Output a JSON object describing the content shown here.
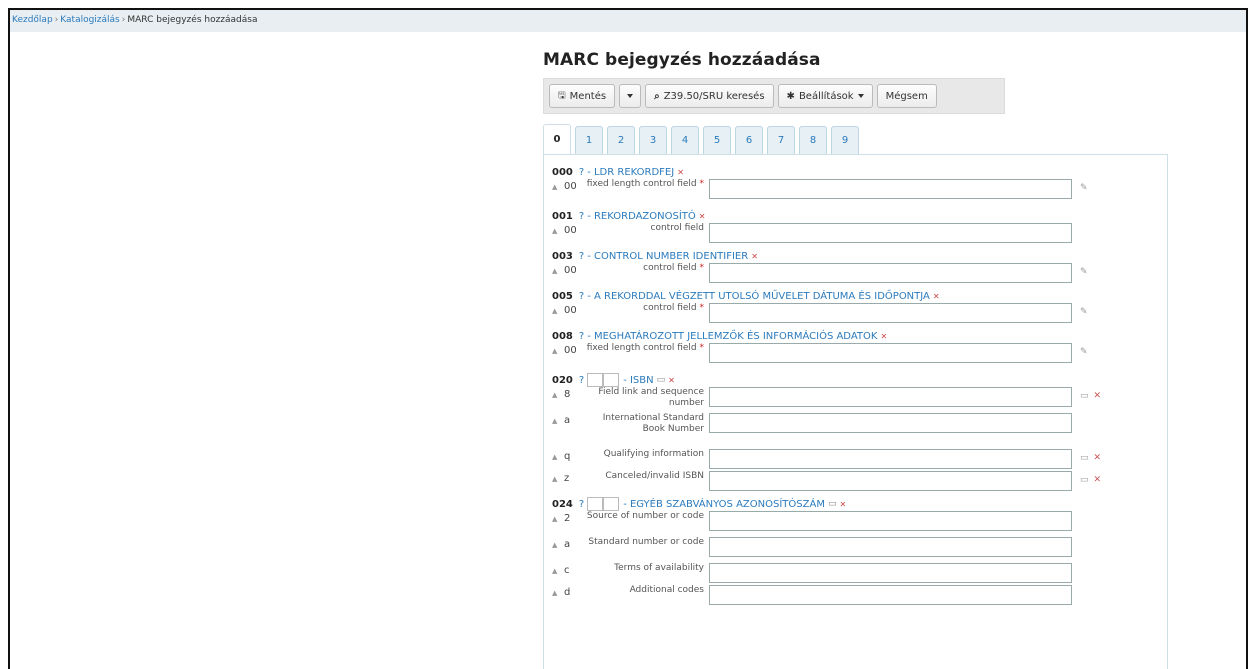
{
  "breadcrumbs": {
    "home": "Kezdőlap",
    "catalog": "Katalogizálás",
    "current": "MARC bejegyzés hozzáadása",
    "sep": "›"
  },
  "page_title": "MARC bejegyzés hozzáadása",
  "toolbar": {
    "save_label": "Mentés",
    "search_label": "Z39.50/SRU keresés",
    "settings_label": "Beállítások",
    "cancel_label": "Mégsem"
  },
  "tabs": [
    "0",
    "1",
    "2",
    "3",
    "4",
    "5",
    "6",
    "7",
    "8",
    "9"
  ],
  "fields": [
    {
      "tag": "000",
      "q": "?",
      "label": "- LDR REKORDFEJ",
      "subfields": [
        {
          "code": "00",
          "label": "fixed length control field",
          "required": "*",
          "icons": "edit"
        }
      ]
    },
    {
      "tag": "001",
      "q": "?",
      "label": "- REKORDAZONOSÍTÓ",
      "subfields": [
        {
          "code": "00",
          "label": "control field",
          "required": "",
          "icons": ""
        }
      ]
    },
    {
      "tag": "003",
      "q": "?",
      "label": "- CONTROL NUMBER IDENTIFIER",
      "subfields": [
        {
          "code": "00",
          "label": "control field",
          "required": "*",
          "icons": "edit"
        }
      ]
    },
    {
      "tag": "005",
      "q": "?",
      "label": "- A REKORDDAL VÉGZETT UTOLSÓ MŰVELET DÁTUMA ÉS IDŐPONTJA",
      "subfields": [
        {
          "code": "00",
          "label": "control field",
          "required": "*",
          "icons": "edit"
        }
      ]
    },
    {
      "tag": "008",
      "q": "?",
      "label": "- MEGHATÁROZOTT JELLEMZŐK ÉS INFORMÁCIÓS ADATOK",
      "subfields": [
        {
          "code": "00",
          "label": "fixed length control field",
          "required": "*",
          "icons": "edit"
        }
      ]
    },
    {
      "tag": "020",
      "q": "?",
      "label": "- ISBN",
      "subfields": [
        {
          "code": "8",
          "label": "Field link and sequence number",
          "required": "",
          "icons": "clone-delete"
        },
        {
          "code": "a",
          "label": "International Standard Book Number",
          "required": "",
          "icons": ""
        },
        {
          "code": "q",
          "label": "Qualifying information",
          "required": "",
          "icons": "clone-delete"
        },
        {
          "code": "z",
          "label": "Canceled/invalid ISBN",
          "required": "",
          "icons": "clone-delete"
        }
      ]
    },
    {
      "tag": "024",
      "q": "?",
      "label": "- EGYÉB SZABVÁNYOS AZONOSÍTÓSZÁM",
      "subfields": [
        {
          "code": "2",
          "label": "Source of number or code",
          "required": "",
          "icons": ""
        },
        {
          "code": "a",
          "label": "Standard number or code",
          "required": "",
          "icons": ""
        },
        {
          "code": "c",
          "label": "Terms of availability",
          "required": "",
          "icons": ""
        },
        {
          "code": "d",
          "label": "Additional codes",
          "required": "",
          "icons": ""
        }
      ]
    }
  ],
  "icons": {
    "save": "floppy-icon",
    "search": "search-icon",
    "settings": "gear-icon",
    "collapse": "collapse-arrow-icon",
    "delete": "delete-field-icon",
    "clone": "clone-field-icon",
    "edit": "edit-plugin-icon"
  },
  "colors": {
    "link": "#2b7bbd",
    "required": "#cc2222",
    "tab_bg": "#e6f0f5"
  }
}
